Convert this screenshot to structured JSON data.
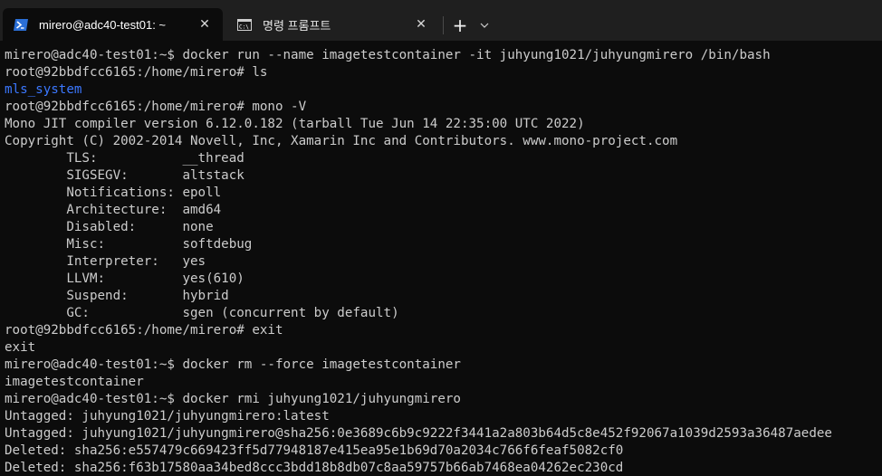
{
  "tabs": [
    {
      "title": "mirero@adc40-test01: ~",
      "icon": "powershell-icon",
      "active": true
    },
    {
      "title": "명령 프롬프트",
      "icon": "cmd-icon",
      "active": false
    }
  ],
  "tab_actions": {
    "new_tab": "+",
    "close": "✕"
  },
  "colors": {
    "background": "#0c0c0c",
    "text": "#cccccc",
    "directory": "#3b78ff",
    "tabbar": "#1f1f1f"
  },
  "terminal": {
    "lines": [
      {
        "text": "mirero@adc40-test01:~$ docker run --name imagetestcontainer -it juhyung1021/juhyungmirero /bin/bash"
      },
      {
        "text": "root@92bbdfcc6165:/home/mirero# ls"
      },
      {
        "text": "mls_system",
        "style": "directory"
      },
      {
        "text": "root@92bbdfcc6165:/home/mirero# mono -V"
      },
      {
        "text": "Mono JIT compiler version 6.12.0.182 (tarball Tue Jun 14 22:35:00 UTC 2022)"
      },
      {
        "text": "Copyright (C) 2002-2014 Novell, Inc, Xamarin Inc and Contributors. www.mono-project.com"
      },
      {
        "text": "        TLS:           __thread"
      },
      {
        "text": "        SIGSEGV:       altstack"
      },
      {
        "text": "        Notifications: epoll"
      },
      {
        "text": "        Architecture:  amd64"
      },
      {
        "text": "        Disabled:      none"
      },
      {
        "text": "        Misc:          softdebug"
      },
      {
        "text": "        Interpreter:   yes"
      },
      {
        "text": "        LLVM:          yes(610)"
      },
      {
        "text": "        Suspend:       hybrid"
      },
      {
        "text": "        GC:            sgen (concurrent by default)"
      },
      {
        "text": "root@92bbdfcc6165:/home/mirero# exit"
      },
      {
        "text": "exit"
      },
      {
        "text": "mirero@adc40-test01:~$ docker rm --force imagetestcontainer"
      },
      {
        "text": "imagetestcontainer"
      },
      {
        "text": "mirero@adc40-test01:~$ docker rmi juhyung1021/juhyungmirero"
      },
      {
        "text": "Untagged: juhyung1021/juhyungmirero:latest"
      },
      {
        "text": "Untagged: juhyung1021/juhyungmirero@sha256:0e3689c6b9c9222f3441a2a803b64d5c8e452f92067a1039d2593a36487aedee"
      },
      {
        "text": "Deleted: sha256:e557479c669423ff5d77948187e415ea95e1b69d70a2034c766f6feaf5082cf0"
      },
      {
        "text": "Deleted: sha256:f63b17580aa34bed8ccc3bdd18b8db07c8aa59757b66ab7468ea04262ec230cd"
      }
    ]
  }
}
